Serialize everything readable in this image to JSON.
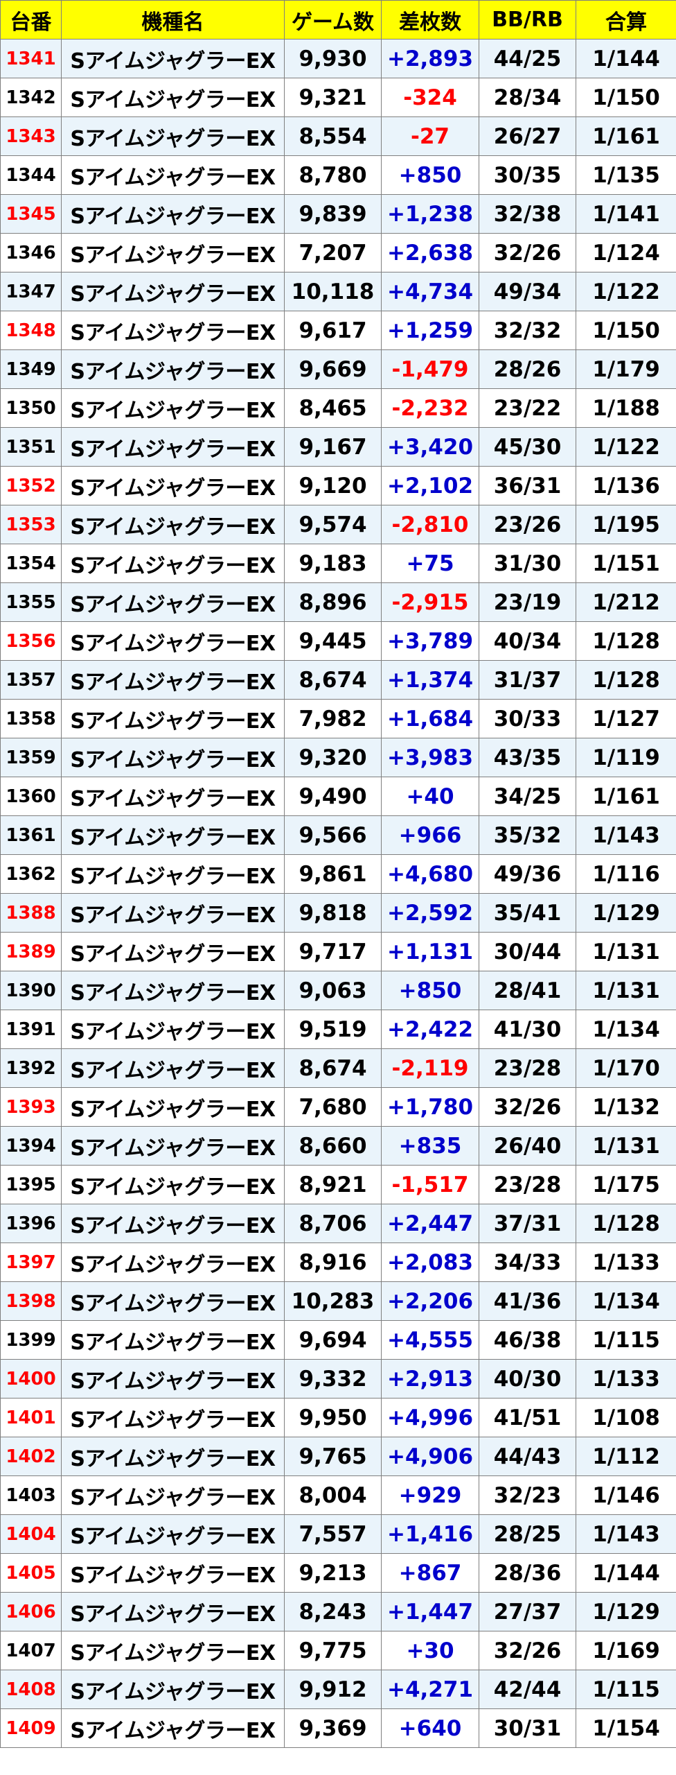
{
  "colors": {
    "header_bg": "#ffff00",
    "row_odd_bg": "#eaf4fb",
    "row_even_bg": "#ffffff",
    "highlight_unit": "#ff0000",
    "plus": "#0000cc",
    "minus": "#ff0000",
    "text": "#000000",
    "border": "#7f7f7f"
  },
  "table": {
    "headers": [
      "台番",
      "機種名",
      "ゲーム数",
      "差枚数",
      "BB/RB",
      "合算"
    ],
    "rows": [
      {
        "unit": "1341",
        "hl": true,
        "model": "SアイムジャグラーEX",
        "games": "9,930",
        "diff": "+2,893",
        "bbrb": "44/25",
        "rate": "1/144"
      },
      {
        "unit": "1342",
        "hl": false,
        "model": "SアイムジャグラーEX",
        "games": "9,321",
        "diff": "-324",
        "bbrb": "28/34",
        "rate": "1/150"
      },
      {
        "unit": "1343",
        "hl": true,
        "model": "SアイムジャグラーEX",
        "games": "8,554",
        "diff": "-27",
        "bbrb": "26/27",
        "rate": "1/161"
      },
      {
        "unit": "1344",
        "hl": false,
        "model": "SアイムジャグラーEX",
        "games": "8,780",
        "diff": "+850",
        "bbrb": "30/35",
        "rate": "1/135"
      },
      {
        "unit": "1345",
        "hl": true,
        "model": "SアイムジャグラーEX",
        "games": "9,839",
        "diff": "+1,238",
        "bbrb": "32/38",
        "rate": "1/141"
      },
      {
        "unit": "1346",
        "hl": false,
        "model": "SアイムジャグラーEX",
        "games": "7,207",
        "diff": "+2,638",
        "bbrb": "32/26",
        "rate": "1/124"
      },
      {
        "unit": "1347",
        "hl": false,
        "model": "SアイムジャグラーEX",
        "games": "10,118",
        "diff": "+4,734",
        "bbrb": "49/34",
        "rate": "1/122"
      },
      {
        "unit": "1348",
        "hl": true,
        "model": "SアイムジャグラーEX",
        "games": "9,617",
        "diff": "+1,259",
        "bbrb": "32/32",
        "rate": "1/150"
      },
      {
        "unit": "1349",
        "hl": false,
        "model": "SアイムジャグラーEX",
        "games": "9,669",
        "diff": "-1,479",
        "bbrb": "28/26",
        "rate": "1/179"
      },
      {
        "unit": "1350",
        "hl": false,
        "model": "SアイムジャグラーEX",
        "games": "8,465",
        "diff": "-2,232",
        "bbrb": "23/22",
        "rate": "1/188"
      },
      {
        "unit": "1351",
        "hl": false,
        "model": "SアイムジャグラーEX",
        "games": "9,167",
        "diff": "+3,420",
        "bbrb": "45/30",
        "rate": "1/122"
      },
      {
        "unit": "1352",
        "hl": true,
        "model": "SアイムジャグラーEX",
        "games": "9,120",
        "diff": "+2,102",
        "bbrb": "36/31",
        "rate": "1/136"
      },
      {
        "unit": "1353",
        "hl": true,
        "model": "SアイムジャグラーEX",
        "games": "9,574",
        "diff": "-2,810",
        "bbrb": "23/26",
        "rate": "1/195"
      },
      {
        "unit": "1354",
        "hl": false,
        "model": "SアイムジャグラーEX",
        "games": "9,183",
        "diff": "+75",
        "bbrb": "31/30",
        "rate": "1/151"
      },
      {
        "unit": "1355",
        "hl": false,
        "model": "SアイムジャグラーEX",
        "games": "8,896",
        "diff": "-2,915",
        "bbrb": "23/19",
        "rate": "1/212"
      },
      {
        "unit": "1356",
        "hl": true,
        "model": "SアイムジャグラーEX",
        "games": "9,445",
        "diff": "+3,789",
        "bbrb": "40/34",
        "rate": "1/128"
      },
      {
        "unit": "1357",
        "hl": false,
        "model": "SアイムジャグラーEX",
        "games": "8,674",
        "diff": "+1,374",
        "bbrb": "31/37",
        "rate": "1/128"
      },
      {
        "unit": "1358",
        "hl": false,
        "model": "SアイムジャグラーEX",
        "games": "7,982",
        "diff": "+1,684",
        "bbrb": "30/33",
        "rate": "1/127"
      },
      {
        "unit": "1359",
        "hl": false,
        "model": "SアイムジャグラーEX",
        "games": "9,320",
        "diff": "+3,983",
        "bbrb": "43/35",
        "rate": "1/119"
      },
      {
        "unit": "1360",
        "hl": false,
        "model": "SアイムジャグラーEX",
        "games": "9,490",
        "diff": "+40",
        "bbrb": "34/25",
        "rate": "1/161"
      },
      {
        "unit": "1361",
        "hl": false,
        "model": "SアイムジャグラーEX",
        "games": "9,566",
        "diff": "+966",
        "bbrb": "35/32",
        "rate": "1/143"
      },
      {
        "unit": "1362",
        "hl": false,
        "model": "SアイムジャグラーEX",
        "games": "9,861",
        "diff": "+4,680",
        "bbrb": "49/36",
        "rate": "1/116"
      },
      {
        "unit": "1388",
        "hl": true,
        "model": "SアイムジャグラーEX",
        "games": "9,818",
        "diff": "+2,592",
        "bbrb": "35/41",
        "rate": "1/129"
      },
      {
        "unit": "1389",
        "hl": true,
        "model": "SアイムジャグラーEX",
        "games": "9,717",
        "diff": "+1,131",
        "bbrb": "30/44",
        "rate": "1/131"
      },
      {
        "unit": "1390",
        "hl": false,
        "model": "SアイムジャグラーEX",
        "games": "9,063",
        "diff": "+850",
        "bbrb": "28/41",
        "rate": "1/131"
      },
      {
        "unit": "1391",
        "hl": false,
        "model": "SアイムジャグラーEX",
        "games": "9,519",
        "diff": "+2,422",
        "bbrb": "41/30",
        "rate": "1/134"
      },
      {
        "unit": "1392",
        "hl": false,
        "model": "SアイムジャグラーEX",
        "games": "8,674",
        "diff": "-2,119",
        "bbrb": "23/28",
        "rate": "1/170"
      },
      {
        "unit": "1393",
        "hl": true,
        "model": "SアイムジャグラーEX",
        "games": "7,680",
        "diff": "+1,780",
        "bbrb": "32/26",
        "rate": "1/132"
      },
      {
        "unit": "1394",
        "hl": false,
        "model": "SアイムジャグラーEX",
        "games": "8,660",
        "diff": "+835",
        "bbrb": "26/40",
        "rate": "1/131"
      },
      {
        "unit": "1395",
        "hl": false,
        "model": "SアイムジャグラーEX",
        "games": "8,921",
        "diff": "-1,517",
        "bbrb": "23/28",
        "rate": "1/175"
      },
      {
        "unit": "1396",
        "hl": false,
        "model": "SアイムジャグラーEX",
        "games": "8,706",
        "diff": "+2,447",
        "bbrb": "37/31",
        "rate": "1/128"
      },
      {
        "unit": "1397",
        "hl": true,
        "model": "SアイムジャグラーEX",
        "games": "8,916",
        "diff": "+2,083",
        "bbrb": "34/33",
        "rate": "1/133"
      },
      {
        "unit": "1398",
        "hl": true,
        "model": "SアイムジャグラーEX",
        "games": "10,283",
        "diff": "+2,206",
        "bbrb": "41/36",
        "rate": "1/134"
      },
      {
        "unit": "1399",
        "hl": false,
        "model": "SアイムジャグラーEX",
        "games": "9,694",
        "diff": "+4,555",
        "bbrb": "46/38",
        "rate": "1/115"
      },
      {
        "unit": "1400",
        "hl": true,
        "model": "SアイムジャグラーEX",
        "games": "9,332",
        "diff": "+2,913",
        "bbrb": "40/30",
        "rate": "1/133"
      },
      {
        "unit": "1401",
        "hl": true,
        "model": "SアイムジャグラーEX",
        "games": "9,950",
        "diff": "+4,996",
        "bbrb": "41/51",
        "rate": "1/108"
      },
      {
        "unit": "1402",
        "hl": true,
        "model": "SアイムジャグラーEX",
        "games": "9,765",
        "diff": "+4,906",
        "bbrb": "44/43",
        "rate": "1/112"
      },
      {
        "unit": "1403",
        "hl": false,
        "model": "SアイムジャグラーEX",
        "games": "8,004",
        "diff": "+929",
        "bbrb": "32/23",
        "rate": "1/146"
      },
      {
        "unit": "1404",
        "hl": true,
        "model": "SアイムジャグラーEX",
        "games": "7,557",
        "diff": "+1,416",
        "bbrb": "28/25",
        "rate": "1/143"
      },
      {
        "unit": "1405",
        "hl": true,
        "model": "SアイムジャグラーEX",
        "games": "9,213",
        "diff": "+867",
        "bbrb": "28/36",
        "rate": "1/144"
      },
      {
        "unit": "1406",
        "hl": true,
        "model": "SアイムジャグラーEX",
        "games": "8,243",
        "diff": "+1,447",
        "bbrb": "27/37",
        "rate": "1/129"
      },
      {
        "unit": "1407",
        "hl": false,
        "model": "SアイムジャグラーEX",
        "games": "9,775",
        "diff": "+30",
        "bbrb": "32/26",
        "rate": "1/169"
      },
      {
        "unit": "1408",
        "hl": true,
        "model": "SアイムジャグラーEX",
        "games": "9,912",
        "diff": "+4,271",
        "bbrb": "42/44",
        "rate": "1/115"
      },
      {
        "unit": "1409",
        "hl": true,
        "model": "SアイムジャグラーEX",
        "games": "9,369",
        "diff": "+640",
        "bbrb": "30/31",
        "rate": "1/154"
      }
    ]
  }
}
